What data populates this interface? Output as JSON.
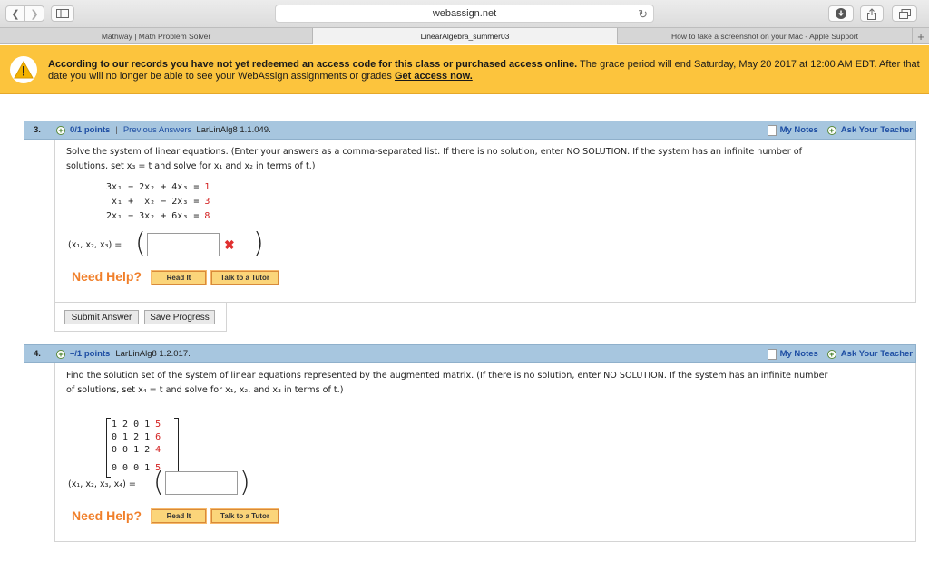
{
  "browser": {
    "url": "webassign.net",
    "tabs": [
      "Mathway | Math Problem Solver",
      "LinearAlgebra_summer03",
      "How to take a screenshot on your Mac - Apple Support"
    ],
    "new_tab": "+"
  },
  "banner": {
    "bold_text": "According to our records you have not yet redeemed an access code for this class or purchased access online.",
    "text": " The grace period will end Saturday, May 20 2017 at 12:00 AM EDT. After that date you will no longer be able to see your WebAssign assignments or grades ",
    "link": "Get access now."
  },
  "q3": {
    "number": "3.",
    "points": "0/1 points",
    "sep": "|",
    "previous": "Previous Answers",
    "ref": "LarLinAlg8 1.1.049.",
    "my_notes": "My Notes",
    "ask": "Ask Your Teacher",
    "prompt_a": "Solve the system of linear equations. (Enter your answers as a comma-separated list. If there is no solution, enter NO SOLUTION. If the system has an infinite number of",
    "prompt_b": "solutions, set x₃ = t and solve for x₁ and x₂ in terms of t.)",
    "equations": [
      {
        "lhs": "3x₁ − 2x₂ + 4x₃ = ",
        "rhs": "1"
      },
      {
        "lhs": " x₁ +  x₂ − 2x₃ = ",
        "rhs": "3"
      },
      {
        "lhs": "2x₁ − 3x₂ + 6x₃ = ",
        "rhs": "8"
      }
    ],
    "answer_label": "(x₁, x₂, x₃) =",
    "answer_value": "",
    "incorrect": "✖",
    "need_help": "Need Help?",
    "read_it": "Read It",
    "talk": "Talk to a Tutor",
    "submit": "Submit Answer",
    "save": "Save Progress"
  },
  "q4": {
    "number": "4.",
    "points": "–/1 points",
    "ref": "LarLinAlg8 1.2.017.",
    "my_notes": "My Notes",
    "ask": "Ask Your Teacher",
    "prompt_a": "Find the solution set of the system of linear equations represented by the augmented matrix. (If there is no solution, enter NO SOLUTION. If the system has an infinite number",
    "prompt_b": "of solutions, set x₄ = t and solve for x₁, x₂, and x₃ in terms of t.)",
    "matrix": [
      {
        "lhs": "1 2 0 1 ",
        "rhs": "5"
      },
      {
        "lhs": "0 1 2 1 ",
        "rhs": "6"
      },
      {
        "lhs": "0 0 1 2 ",
        "rhs": "4"
      },
      {
        "lhs": "0 0 0 1 ",
        "rhs": "5"
      }
    ],
    "answer_label": "(x₁, x₂, x₃, x₄) =",
    "answer_value": "",
    "need_help": "Need Help?",
    "read_it": "Read It",
    "talk": "Talk to a Tutor"
  }
}
